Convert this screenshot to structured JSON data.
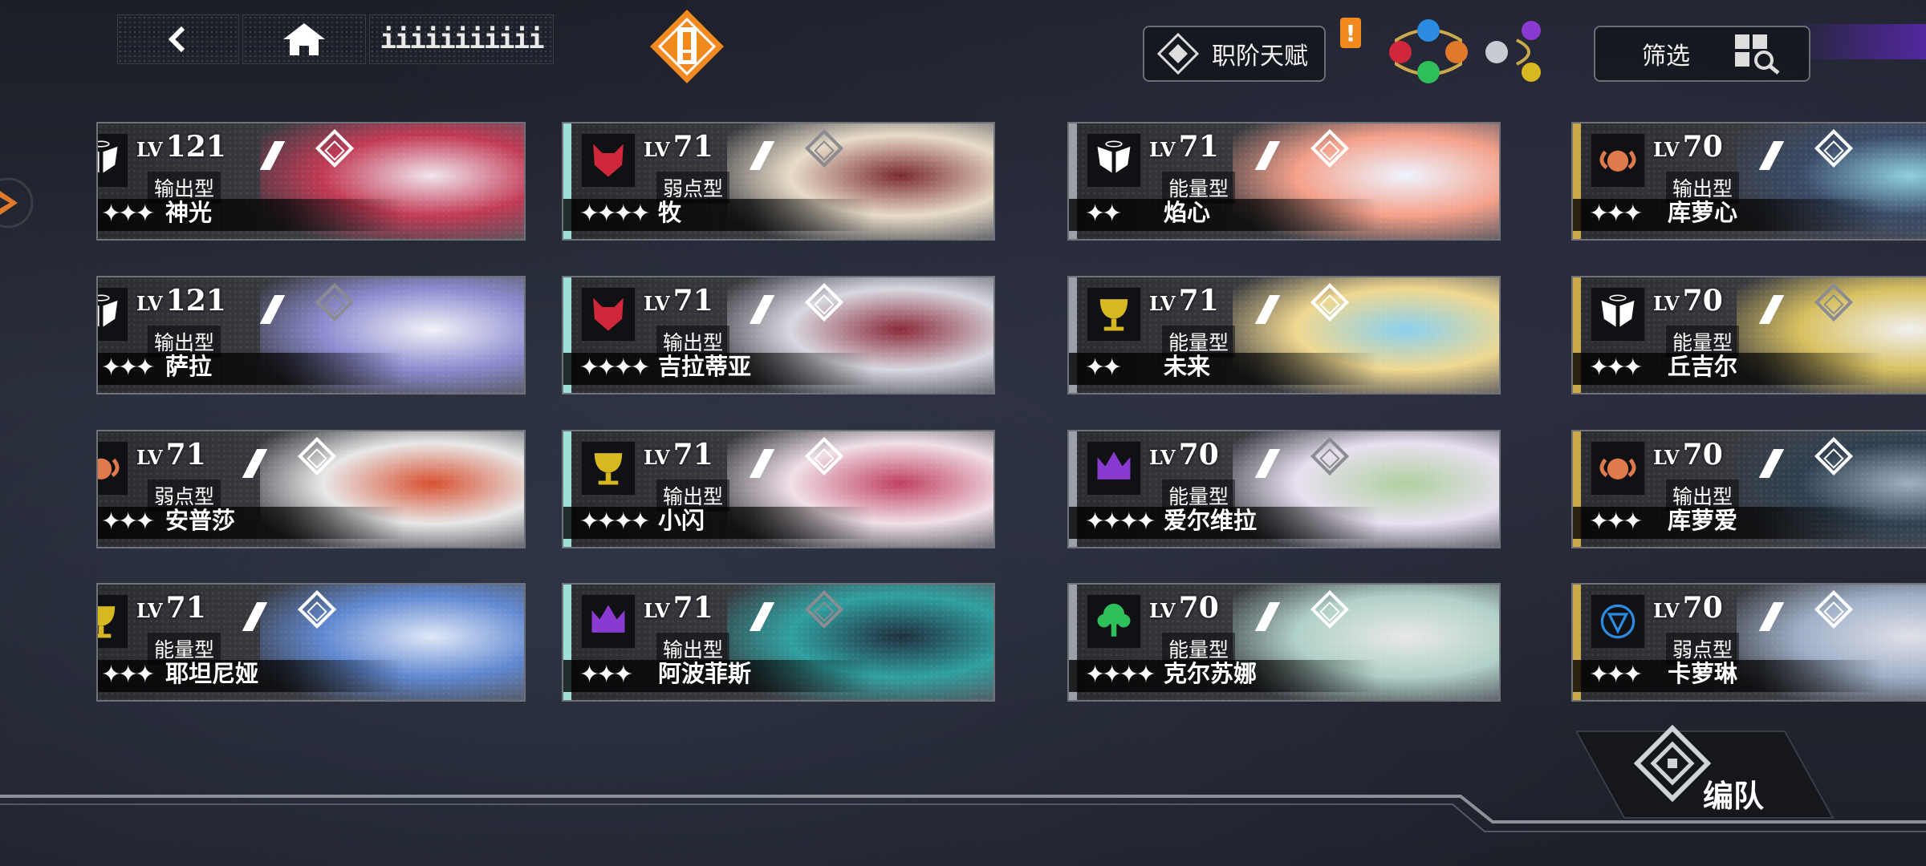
{
  "header": {
    "title_text": "iiiiiiiiiii",
    "talent_label": "职阶天赋",
    "talent_badge": "!",
    "filter_label": "筛选",
    "center_alert": "!"
  },
  "colors": {
    "accent_orange": "#f08a1f",
    "gold_edge": "#c9a94a",
    "silver_edge": "#9aa0a8",
    "rainbow_edge": "#9ee0d8"
  },
  "cards": [
    {
      "lv_prefix": "LV",
      "level": "121",
      "type": "输出型",
      "stars": "✦✦✦",
      "name": "神光",
      "icon": "angel-wings-icon"
    },
    {
      "lv_prefix": "LV",
      "level": "71",
      "type": "弱点型",
      "stars": "✦✦✦✦",
      "name": "牧",
      "icon": "wolf-icon"
    },
    {
      "lv_prefix": "LV",
      "level": "71",
      "type": "能量型",
      "stars": "✦✦",
      "name": "焰心",
      "icon": "angel-wings-icon"
    },
    {
      "lv_prefix": "LV",
      "level": "70",
      "type": "输出型",
      "stars": "✦✦✦",
      "name": "库萝心",
      "icon": "ram-icon"
    },
    {
      "lv_prefix": "LV",
      "level": "121",
      "type": "输出型",
      "stars": "✦✦✦",
      "name": "萨拉",
      "icon": "angel-wings-icon"
    },
    {
      "lv_prefix": "LV",
      "level": "71",
      "type": "输出型",
      "stars": "✦✦✦✦",
      "name": "吉拉蒂亚",
      "icon": "wolf-icon"
    },
    {
      "lv_prefix": "LV",
      "level": "71",
      "type": "能量型",
      "stars": "✦✦",
      "name": "未来",
      "icon": "chalice-icon"
    },
    {
      "lv_prefix": "LV",
      "level": "70",
      "type": "能量型",
      "stars": "✦✦✦",
      "name": "丘吉尔",
      "icon": "angel-wings-icon"
    },
    {
      "lv_prefix": "LV",
      "level": "71",
      "type": "弱点型",
      "stars": "✦✦✦",
      "name": "安普莎",
      "icon": "ram-icon"
    },
    {
      "lv_prefix": "LV",
      "level": "71",
      "type": "输出型",
      "stars": "✦✦✦✦",
      "name": "小闪",
      "icon": "chalice-icon"
    },
    {
      "lv_prefix": "LV",
      "level": "70",
      "type": "能量型",
      "stars": "✦✦✦✦",
      "name": "爱尔维拉",
      "icon": "crown-icon"
    },
    {
      "lv_prefix": "LV",
      "level": "70",
      "type": "输出型",
      "stars": "✦✦✦",
      "name": "库萝爱",
      "icon": "ram-icon"
    },
    {
      "lv_prefix": "LV",
      "level": "71",
      "type": "能量型",
      "stars": "✦✦✦",
      "name": "耶坦尼娅",
      "icon": "chalice-icon"
    },
    {
      "lv_prefix": "LV",
      "level": "71",
      "type": "输出型",
      "stars": "✦✦✦",
      "name": "阿波菲斯",
      "icon": "crown-icon"
    },
    {
      "lv_prefix": "LV",
      "level": "70",
      "type": "能量型",
      "stars": "✦✦✦✦",
      "name": "克尔苏娜",
      "icon": "tree-icon"
    },
    {
      "lv_prefix": "LV",
      "level": "70",
      "type": "弱点型",
      "stars": "✦✦✦",
      "name": "卡萝琳",
      "icon": "shield-icon"
    }
  ],
  "footer": {
    "formation_label": "编队"
  }
}
